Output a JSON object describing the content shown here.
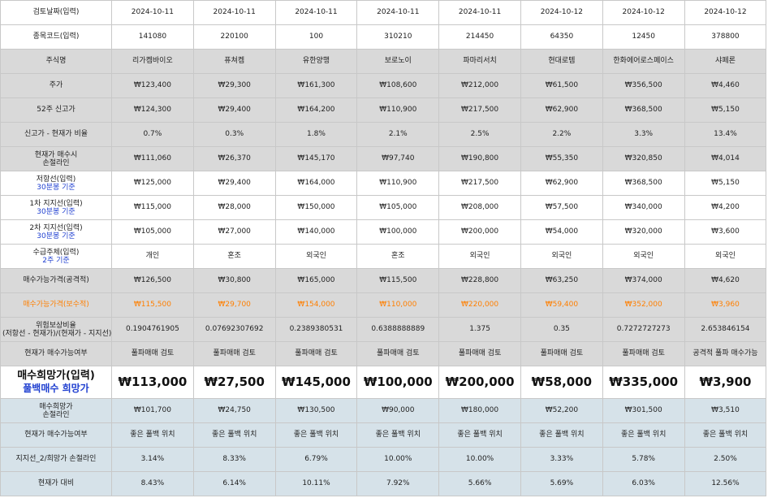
{
  "sheet": {
    "rows": [
      {
        "label": "검토날짜(입력)",
        "style": "white",
        "values": [
          "2024-10-11",
          "2024-10-11",
          "2024-10-11",
          "2024-10-11",
          "2024-10-11",
          "2024-10-12",
          "2024-10-12",
          "2024-10-12"
        ]
      },
      {
        "label": "종목코드(입력)",
        "style": "white",
        "values": [
          "141080",
          "220100",
          "100",
          "310210",
          "214450",
          "64350",
          "12450",
          "378800"
        ]
      },
      {
        "label": "주식명",
        "style": "gray",
        "values": [
          "리가켐바이오",
          "퓨쳐켐",
          "유한양행",
          "보로노이",
          "파마리서치",
          "현대로템",
          "한화에어로스페이스",
          "샤페론"
        ]
      },
      {
        "label": "주가",
        "style": "gray",
        "values": [
          "₩123,400",
          "₩29,300",
          "₩161,300",
          "₩108,600",
          "₩212,000",
          "₩61,500",
          "₩356,500",
          "₩4,460"
        ]
      },
      {
        "label": "52주 신고가",
        "style": "gray",
        "values": [
          "₩124,300",
          "₩29,400",
          "₩164,200",
          "₩110,900",
          "₩217,500",
          "₩62,900",
          "₩368,500",
          "₩5,150"
        ]
      },
      {
        "label": "신고가 - 현재가 비율",
        "style": "gray",
        "values": [
          "0.7%",
          "0.3%",
          "1.8%",
          "2.1%",
          "2.5%",
          "2.2%",
          "3.3%",
          "13.4%"
        ]
      },
      {
        "label": "현재가 매수시",
        "sublabel": "손절라인",
        "substyle": "plain",
        "style": "gray",
        "values": [
          "₩111,060",
          "₩26,370",
          "₩145,170",
          "₩97,740",
          "₩190,800",
          "₩55,350",
          "₩320,850",
          "₩4,014"
        ]
      },
      {
        "label": "저항선(입력)",
        "sublabel": "30분봉 기준",
        "style": "white",
        "values": [
          "₩125,000",
          "₩29,400",
          "₩164,000",
          "₩110,900",
          "₩217,500",
          "₩62,900",
          "₩368,500",
          "₩5,150"
        ]
      },
      {
        "label": "1차 지지선(입력)",
        "sublabel": "30분봉 기준",
        "style": "white",
        "values": [
          "₩115,000",
          "₩28,000",
          "₩150,000",
          "₩105,000",
          "₩208,000",
          "₩57,500",
          "₩340,000",
          "₩4,200"
        ]
      },
      {
        "label": "2차 지지선(입력)",
        "sublabel": "30분봉 기준",
        "style": "white",
        "values": [
          "₩105,000",
          "₩27,000",
          "₩140,000",
          "₩100,000",
          "₩200,000",
          "₩54,000",
          "₩320,000",
          "₩3,600"
        ]
      },
      {
        "label": "수급주체(입력)",
        "sublabel": "2주 기준",
        "style": "white",
        "values": [
          "개인",
          "혼조",
          "외국인",
          "혼조",
          "외국인",
          "외국인",
          "외국인",
          "외국인"
        ]
      },
      {
        "label": "매수가능가격(공격적)",
        "style": "gray",
        "values": [
          "₩126,500",
          "₩30,800",
          "₩165,000",
          "₩115,500",
          "₩228,800",
          "₩63,250",
          "₩374,000",
          "₩4,620"
        ]
      },
      {
        "label": "매수가능가격(보수적)",
        "style": "gray orange",
        "values": [
          "₩115,500",
          "₩29,700",
          "₩154,000",
          "₩110,000",
          "₩220,000",
          "₩59,400",
          "₩352,000",
          "₩3,960"
        ]
      },
      {
        "label": "위험보상비율",
        "sublabel": "(저항선 - 현재가)/(현재가 - 지지선)",
        "substyle": "plain",
        "style": "gray",
        "values": [
          "0.1904761905",
          "0.07692307692",
          "0.2389380531",
          "0.6388888889",
          "1.375",
          "0.35",
          "0.7272727273",
          "2.653846154"
        ]
      },
      {
        "label": "현재가 매수가능여부",
        "style": "gray",
        "values": [
          "풀파매매 검토",
          "풀파매매 검토",
          "풀파매매 검토",
          "풀파매매 검토",
          "풀파매매 검토",
          "풀파매매 검토",
          "풀파매매 검토",
          "공격적 풀파 매수가능"
        ]
      },
      {
        "label": "매수희망가(입력)",
        "sublabel": "풀백매수 희망가",
        "style": "white big",
        "values": [
          "₩113,000",
          "₩27,500",
          "₩145,000",
          "₩100,000",
          "₩200,000",
          "₩58,000",
          "₩335,000",
          "₩3,900"
        ]
      },
      {
        "label": "매수희망가",
        "sublabel": "손절라인",
        "substyle": "plain",
        "style": "teal",
        "values": [
          "₩101,700",
          "₩24,750",
          "₩130,500",
          "₩90,000",
          "₩180,000",
          "₩52,200",
          "₩301,500",
          "₩3,510"
        ]
      },
      {
        "label": "현재가 매수가능여부",
        "style": "teal",
        "values": [
          "좋은 풀백 위치",
          "좋은 풀백 위치",
          "좋은 풀백 위치",
          "좋은 풀백 위치",
          "좋은 풀백 위치",
          "좋은 풀백 위치",
          "좋은 풀백 위치",
          "좋은 풀백 위치"
        ]
      },
      {
        "label": "지지선_2/희망가 손절라인",
        "style": "teal",
        "values": [
          "3.14%",
          "8.33%",
          "6.79%",
          "10.00%",
          "10.00%",
          "3.33%",
          "5.78%",
          "2.50%"
        ]
      },
      {
        "label": "현재가 대비",
        "style": "teal",
        "values": [
          "8.43%",
          "6.14%",
          "10.11%",
          "7.92%",
          "5.66%",
          "5.69%",
          "6.03%",
          "12.56%"
        ]
      }
    ]
  }
}
